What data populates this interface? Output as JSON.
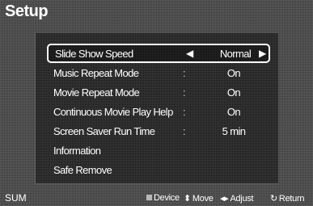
{
  "header": {
    "title": "Setup"
  },
  "menu": {
    "items": [
      {
        "label": "Slide Show Speed",
        "value": "Normal",
        "selected": true
      },
      {
        "label": "Music Repeat Mode",
        "colon": ":",
        "value": "On"
      },
      {
        "label": "Movie Repeat Mode",
        "colon": ":",
        "value": "On"
      },
      {
        "label": "Continuous Movie Play Help",
        "colon": ":",
        "value": "On"
      },
      {
        "label": "Screen Saver Run Time",
        "colon": ":",
        "value": "5 min"
      },
      {
        "label": "Information"
      },
      {
        "label": "Safe Remove"
      }
    ],
    "left_arrow": "◀",
    "right_arrow": "▶"
  },
  "footer": {
    "sum": "SUM",
    "device": "Device",
    "move": "Move",
    "adjust": "Adjust",
    "return": "Return",
    "icons": {
      "device": "square-icon",
      "move": "up-down-arrow-icon",
      "adjust": "left-right-arrow-icon",
      "return": "return-arrow-icon"
    }
  },
  "colors": {
    "selection_border": "#ffffff",
    "background": "#3a3a3a",
    "text": "#ffffff"
  }
}
